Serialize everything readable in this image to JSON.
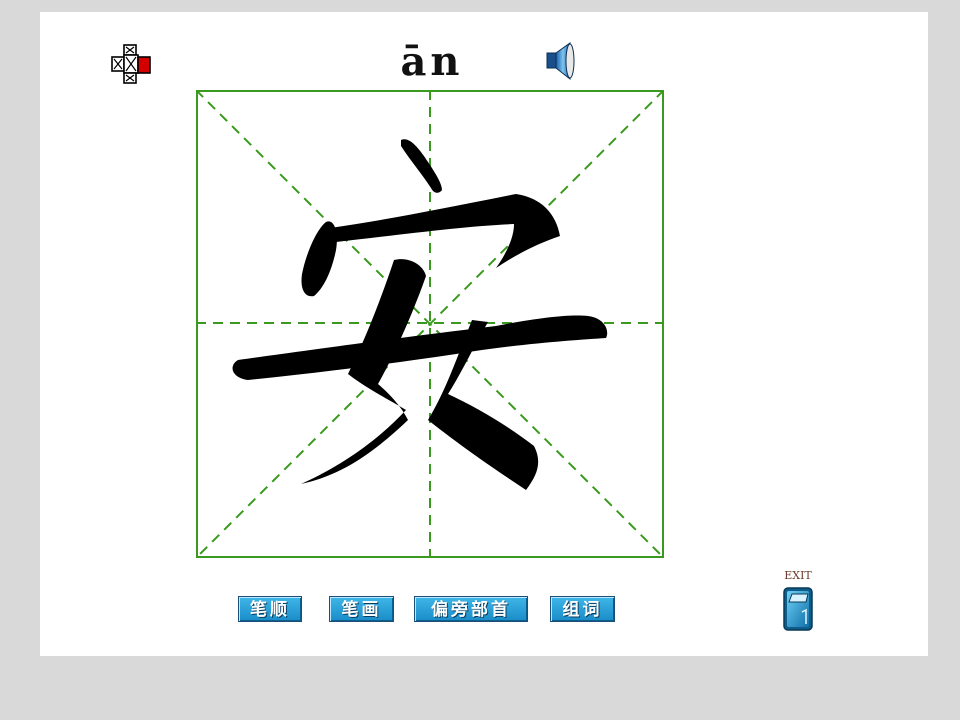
{
  "lesson": {
    "pinyin": "ān",
    "character": "安"
  },
  "toolbar": {
    "buttons": [
      {
        "label": "笔顺"
      },
      {
        "label": "笔画"
      },
      {
        "label": "偏旁部首"
      },
      {
        "label": "组词"
      }
    ]
  },
  "exit": {
    "label": "EXIT"
  },
  "icons": {
    "logo": "puzzle-cross-icon",
    "sound": "speaker-icon",
    "exit": "door-exit-icon"
  },
  "colors": {
    "grid_green": "#3a9a1f",
    "button_blue": "#2aa2db",
    "ink": "#000000"
  }
}
